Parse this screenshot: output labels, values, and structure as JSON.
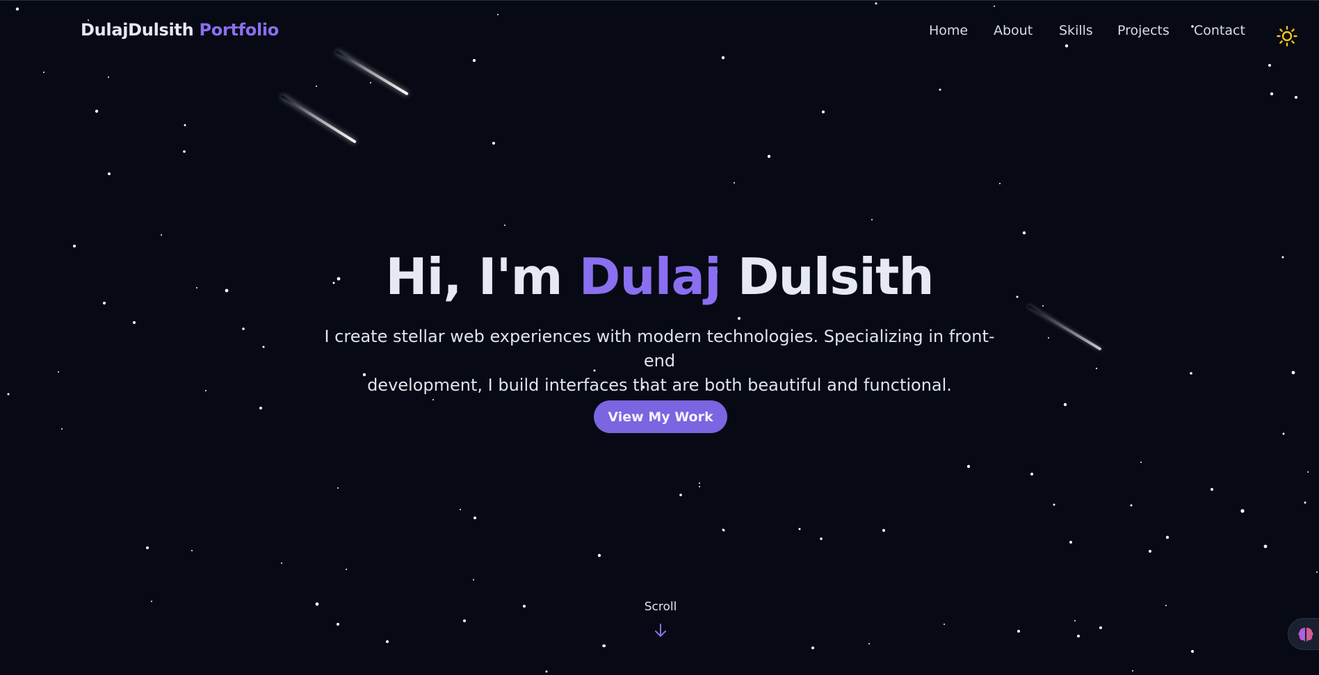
{
  "header": {
    "brand_name": "DulajDulsith",
    "brand_accent": "Portfolio",
    "nav": [
      {
        "label": "Home"
      },
      {
        "label": "About"
      },
      {
        "label": "Skills"
      },
      {
        "label": "Projects"
      },
      {
        "label": "Contact"
      }
    ],
    "theme_toggle_icon": "sun-icon"
  },
  "hero": {
    "title_prefix": "Hi, I'm",
    "title_accent": "Dulaj",
    "title_suffix": "Dulsith",
    "subtitle_line1": "I create stellar web experiences with modern technologies. Specializing in front-end",
    "subtitle_line2": "development, I build interfaces that are both beautiful and functional.",
    "cta_label": "View My Work"
  },
  "scroll": {
    "label": "Scroll",
    "icon": "arrow-down-icon"
  },
  "floating_widget": {
    "icon": "brain-icon"
  },
  "colors": {
    "background": "#070a14",
    "accent": "#8a6ff0",
    "button": "#7b65e0",
    "text": "#e6e9f2",
    "sun": "#f5c518"
  }
}
